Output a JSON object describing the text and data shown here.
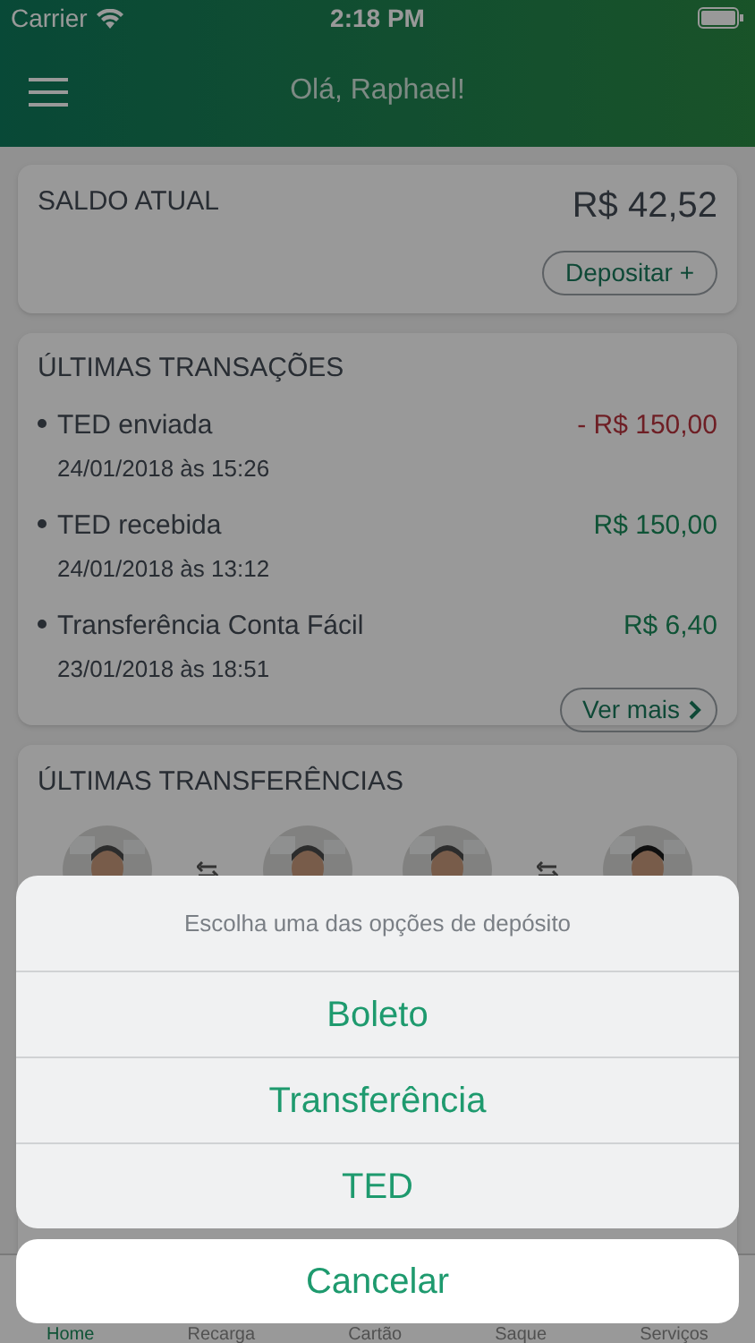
{
  "status_bar": {
    "carrier": "Carrier",
    "time": "2:18 PM"
  },
  "header": {
    "title": "Olá, Raphael!"
  },
  "balance": {
    "label": "SALDO ATUAL",
    "amount": "R$ 42,52",
    "button": "Depositar +"
  },
  "transactions": {
    "title": "ÚLTIMAS TRANSAÇÕES",
    "items": [
      {
        "name": "TED enviada",
        "date": "24/01/2018 às 15:26",
        "amount": "- R$ 150,00",
        "kind": "debit"
      },
      {
        "name": "TED recebida",
        "date": "24/01/2018 às 13:12",
        "amount": "R$ 150,00",
        "kind": "credit"
      },
      {
        "name": "Transferência Conta Fácil",
        "date": "23/01/2018 às 18:51",
        "amount": "R$ 6,40",
        "kind": "credit"
      }
    ],
    "more_button": "Ver mais"
  },
  "transfers": {
    "title": "ÚLTIMAS TRANSFERÊNCIAS"
  },
  "tab_bar": [
    {
      "label": "Home",
      "selected": true
    },
    {
      "label": "Recarga",
      "selected": false
    },
    {
      "label": "Cartão",
      "selected": false
    },
    {
      "label": "Saque",
      "selected": false
    },
    {
      "label": "Serviços",
      "selected": false
    }
  ],
  "action_sheet": {
    "title": "Escolha uma das opções de depósito",
    "options": [
      "Boleto",
      "Transferência",
      "TED"
    ],
    "cancel": "Cancelar"
  }
}
